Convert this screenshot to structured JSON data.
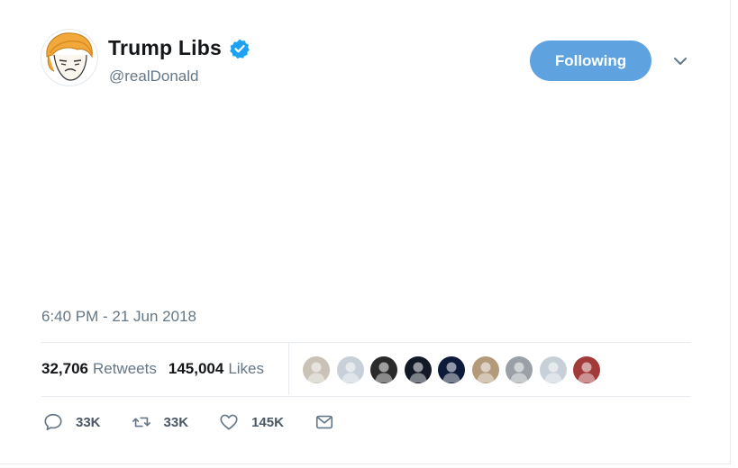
{
  "tweet": {
    "display_name": "Trump Libs",
    "handle": "@realDonald",
    "verified": true,
    "timestamp": "6:40 PM - 21 Jun 2018"
  },
  "follow_button": {
    "label": "Following",
    "color": "#5ea3e0"
  },
  "stats": {
    "retweets_count": "32,706",
    "retweets_label": "Retweets",
    "likes_count": "145,004",
    "likes_label": "Likes"
  },
  "likers": [
    {
      "name": "liker-avatar-1",
      "color": "#c9c2b6"
    },
    {
      "name": "liker-avatar-2",
      "color": "#c7d0d8"
    },
    {
      "name": "liker-avatar-3",
      "color": "#2a2a2a"
    },
    {
      "name": "liker-avatar-4",
      "color": "#121826"
    },
    {
      "name": "liker-avatar-5",
      "color": "#0d1a3a"
    },
    {
      "name": "liker-avatar-6",
      "color": "#b39a7a"
    },
    {
      "name": "liker-avatar-7",
      "color": "#9aa0a6"
    },
    {
      "name": "liker-avatar-8",
      "color": "#c7d0d8"
    },
    {
      "name": "liker-avatar-9",
      "color": "#a33a3a"
    }
  ],
  "actions": {
    "reply_count": "33K",
    "retweet_count": "33K",
    "like_count": "145K"
  },
  "icons": {
    "verified": "verified-badge-icon",
    "caret": "chevron-down-icon",
    "reply": "reply-icon",
    "retweet": "retweet-icon",
    "like": "heart-icon",
    "dm": "envelope-icon"
  },
  "colors": {
    "accent": "#1da1f2",
    "secondary_text": "#657786",
    "divider": "#e6ecf0"
  }
}
